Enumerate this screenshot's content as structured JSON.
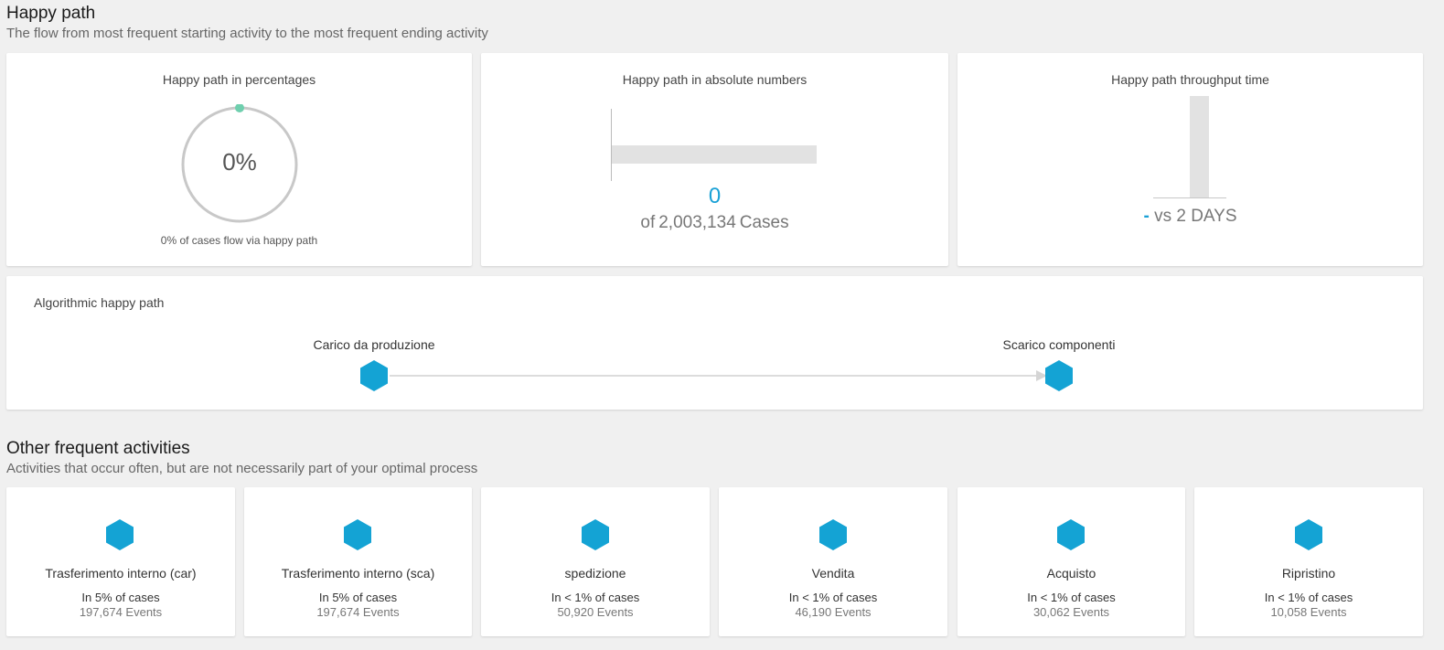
{
  "happy_path": {
    "title": "Happy path",
    "subtitle": "The flow from most frequent starting activity to the most frequent ending activity",
    "percent_card": {
      "title": "Happy path in percentages",
      "value": "0%",
      "fraction": 0,
      "caption": "0% of cases flow via happy path",
      "ring_color": "#c8c8c8",
      "marker_color": "#6fcfae"
    },
    "absolute_card": {
      "title": "Happy path in absolute numbers",
      "value": "0",
      "of_label": "of",
      "total": "2,003,134",
      "unit": "Cases",
      "accent_color": "#1aa1d6"
    },
    "throughput_card": {
      "title": "Happy path throughput time",
      "value": "-",
      "vs_label": "vs",
      "reference": "2 DAYS"
    }
  },
  "algorithmic": {
    "title": "Algorithmic happy path",
    "start_label": "Carico da produzione",
    "end_label": "Scarico componenti",
    "node_icon": "hexagon-icon",
    "node_color": "#14a3d4"
  },
  "frequent": {
    "title": "Other frequent activities",
    "subtitle": "Activities that occur often, but are not necessarily part of your optimal process",
    "items": [
      {
        "name": "Trasferimento interno (car)",
        "pct": "In 5% of cases",
        "events": "197,674 Events"
      },
      {
        "name": "Trasferimento interno (sca)",
        "pct": "In 5% of cases",
        "events": "197,674 Events"
      },
      {
        "name": "spedizione",
        "pct": "In < 1% of cases",
        "events": "50,920 Events"
      },
      {
        "name": "Vendita",
        "pct": "In < 1% of cases",
        "events": "46,190 Events"
      },
      {
        "name": "Acquisto",
        "pct": "In < 1% of cases",
        "events": "30,062 Events"
      },
      {
        "name": "Ripristino",
        "pct": "In < 1% of cases",
        "events": "10,058 Events"
      }
    ]
  }
}
